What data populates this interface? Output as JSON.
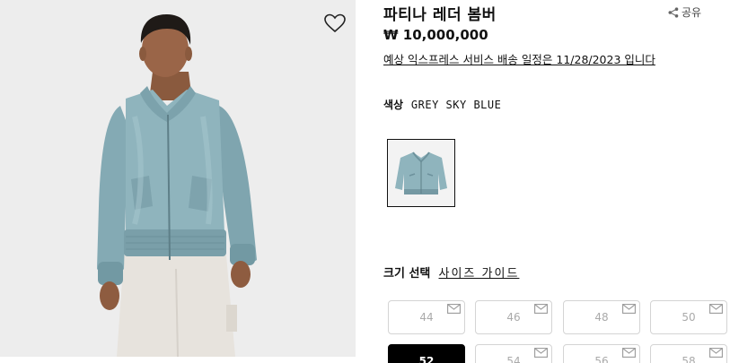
{
  "product": {
    "title": "파티나 레더 봄버",
    "price": "₩ 10,000,000",
    "delivery_note": "예상 익스프레스 서비스 배송 일정은 11/28/2023 입니다",
    "share_label": "공유"
  },
  "color": {
    "label": "색상",
    "value": "GREY SKY BLUE",
    "jacket_color": "#8fb4bd"
  },
  "size": {
    "label": "크기 선택",
    "guide_label": "사이즈 가이드",
    "options": [
      "44",
      "46",
      "48",
      "50",
      "52",
      "54",
      "56",
      "58"
    ],
    "selected": "52"
  },
  "icons": {
    "wishlist": "heart-icon",
    "share": "share-icon",
    "notify": "mail-icon"
  }
}
